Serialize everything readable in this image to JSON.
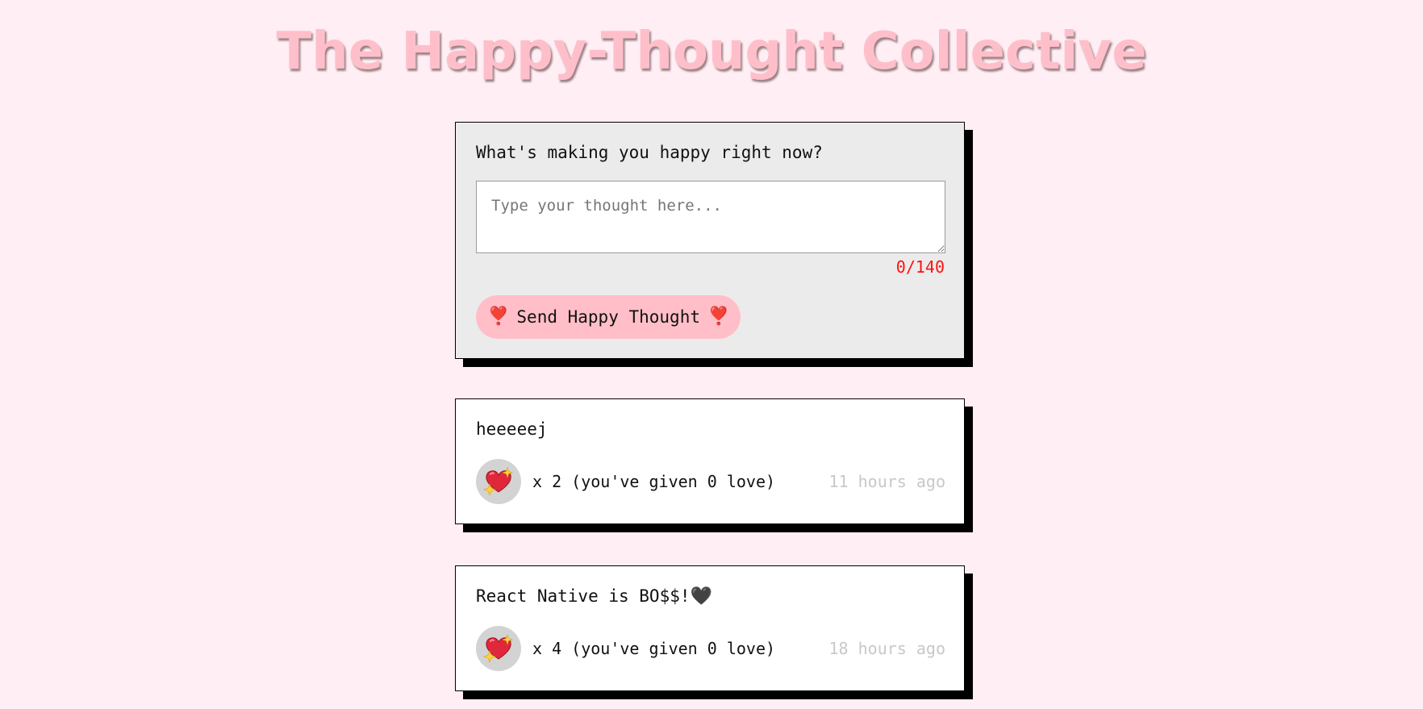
{
  "header": {
    "title": "The Happy-Thought Collective"
  },
  "composer": {
    "prompt": "What's making you happy right now?",
    "input_value": "",
    "input_placeholder": "Type your thought here...",
    "char_count": "0/140",
    "send_label": "Send Happy Thought",
    "send_icon": "heart-exclamation-icon"
  },
  "thoughts": [
    {
      "message": "heeeeej",
      "message_emoji": "",
      "like_icon": "sparkling-heart-icon",
      "likes_text": "x 2 (you've given 0 love)",
      "time": "11 hours ago"
    },
    {
      "message": "React Native is BO$$!",
      "message_emoji": "🖤",
      "like_icon": "sparkling-heart-icon",
      "likes_text": "x 4 (you've given 0 love)",
      "time": "18 hours ago"
    }
  ],
  "colors": {
    "background": "#ffeef3",
    "title": "#ffbfca",
    "composer_bg": "#ebebeb",
    "button_bg": "#ffbec8",
    "counter": "#ff1010",
    "like_button_bg": "#d3d3d3",
    "timestamp": "#c8c8c8"
  }
}
